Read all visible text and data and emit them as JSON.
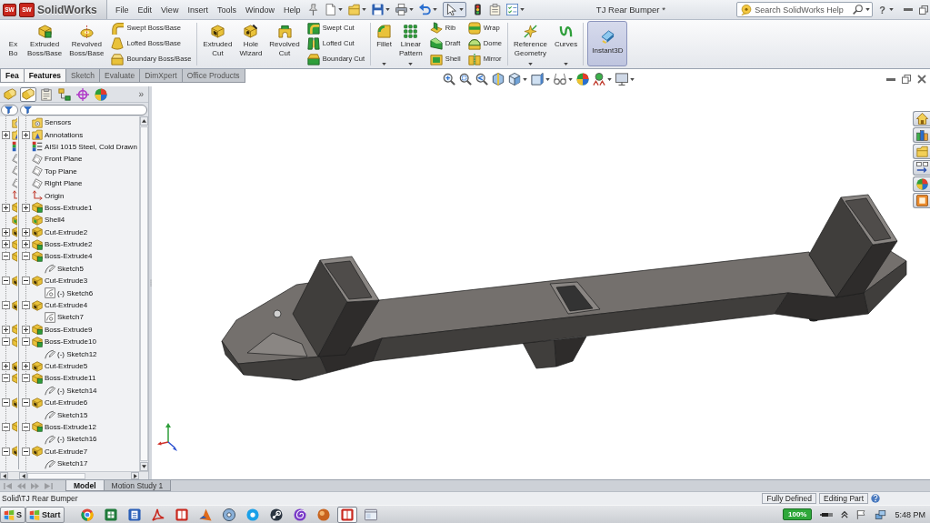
{
  "title_bar": {
    "app_icon_mark": "SW",
    "logo": {
      "mark": "SW",
      "text": "SolidWorks"
    },
    "menu": [
      "File",
      "Edit",
      "View",
      "Insert",
      "Tools",
      "Window",
      "Help"
    ],
    "select_tool": {
      "pressed": true
    },
    "document_title": "TJ Rear Bumper *",
    "search": {
      "placeholder": "Search SolidWorks Help"
    },
    "help_glyph": "?"
  },
  "command_manager": {
    "groups": [
      {
        "tools": [
          {
            "kind": "large",
            "label": "Ex Bo",
            "dropdown": false
          },
          {
            "kind": "large",
            "label": "Extruded Boss/Base",
            "dropdown": false
          },
          {
            "kind": "large",
            "label": "Revolved Boss/Base",
            "dropdown": false
          },
          {
            "kind": "stack",
            "items": [
              "Swept Boss/Base",
              "Lofted Boss/Base",
              "Boundary Boss/Base"
            ]
          }
        ]
      },
      {
        "tools": [
          {
            "kind": "large",
            "label": "Extruded Cut",
            "dropdown": false
          },
          {
            "kind": "large",
            "label": "Hole Wizard",
            "dropdown": false
          },
          {
            "kind": "large",
            "label": "Revolved Cut",
            "dropdown": false
          },
          {
            "kind": "stack",
            "items": [
              "Swept Cut",
              "Lofted Cut",
              "Boundary Cut"
            ]
          }
        ]
      },
      {
        "tools": [
          {
            "kind": "large",
            "label": "Fillet",
            "dropdown": true
          },
          {
            "kind": "large",
            "label": "Linear Pattern",
            "dropdown": true
          },
          {
            "kind": "stack",
            "items": [
              "Rib",
              "Draft",
              "Shell"
            ]
          },
          {
            "kind": "stack",
            "items": [
              "Wrap",
              "Dome",
              "Mirror"
            ]
          }
        ]
      },
      {
        "tools": [
          {
            "kind": "large",
            "label": "Reference Geometry",
            "dropdown": true
          },
          {
            "kind": "large",
            "label": "Curves",
            "dropdown": true
          }
        ]
      },
      {
        "tools": [
          {
            "kind": "toggle",
            "label": "Instant3D",
            "on": true
          }
        ]
      }
    ]
  },
  "tabs": [
    {
      "label": "Fea",
      "selected": true
    },
    {
      "label": "Features",
      "selected": true
    },
    {
      "label": "Sketch",
      "selected": false
    },
    {
      "label": "Evaluate",
      "selected": false
    },
    {
      "label": "DimXpert",
      "selected": false
    },
    {
      "label": "Office Products",
      "selected": false
    }
  ],
  "feature_tree": {
    "panel_tabs": [
      {
        "selected": false
      },
      {
        "selected": true
      },
      {
        "selected": false
      },
      {
        "selected": false
      },
      {
        "selected": false
      },
      {
        "selected": false
      }
    ],
    "overflow_glyph": "»",
    "items": [
      {
        "label": "Sensors",
        "kind": "sensors"
      },
      {
        "label": "Annotations",
        "kind": "annotations",
        "expanded": false
      },
      {
        "label": "AISI 1015 Steel, Cold Drawn",
        "kind": "material"
      },
      {
        "label": "Front Plane",
        "kind": "plane"
      },
      {
        "label": "Top Plane",
        "kind": "plane"
      },
      {
        "label": "Right Plane",
        "kind": "plane"
      },
      {
        "label": "Origin",
        "kind": "origin"
      },
      {
        "label": "Boss-Extrude1",
        "kind": "boss",
        "expanded": false
      },
      {
        "label": "Shell4",
        "kind": "shell"
      },
      {
        "label": "Cut-Extrude2",
        "kind": "cut",
        "expanded": false
      },
      {
        "label": "Boss-Extrude2",
        "kind": "boss",
        "expanded": false
      },
      {
        "label": "Boss-Extrude4",
        "kind": "boss",
        "expanded": true,
        "children": [
          {
            "label": "Sketch5",
            "kind": "sketch"
          }
        ]
      },
      {
        "label": "Cut-Extrude3",
        "kind": "cut",
        "expanded": true,
        "children": [
          {
            "label": "(-) Sketch6",
            "kind": "sketchbox"
          }
        ]
      },
      {
        "label": "Cut-Extrude4",
        "kind": "cut",
        "expanded": true,
        "children": [
          {
            "label": "Sketch7",
            "kind": "sketchbox"
          }
        ]
      },
      {
        "label": "Boss-Extrude9",
        "kind": "boss",
        "expanded": false
      },
      {
        "label": "Boss-Extrude10",
        "kind": "boss",
        "expanded": true,
        "children": [
          {
            "label": "(-) Sketch12",
            "kind": "sketch"
          }
        ]
      },
      {
        "label": "Cut-Extrude5",
        "kind": "cut",
        "expanded": false
      },
      {
        "label": "Boss-Extrude11",
        "kind": "boss",
        "expanded": true,
        "children": [
          {
            "label": "(-) Sketch14",
            "kind": "sketch"
          }
        ]
      },
      {
        "label": "Cut-Extrude6",
        "kind": "cut",
        "expanded": true,
        "children": [
          {
            "label": "Sketch15",
            "kind": "sketch"
          }
        ]
      },
      {
        "label": "Boss-Extrude12",
        "kind": "boss",
        "expanded": true,
        "children": [
          {
            "label": "(-) Sketch16",
            "kind": "sketch"
          }
        ]
      },
      {
        "label": "Cut-Extrude7",
        "kind": "cut",
        "expanded": true,
        "children": [
          {
            "label": "Sketch17",
            "kind": "sketch"
          }
        ]
      }
    ]
  },
  "model_tab_bar": {
    "nav_disabled": true,
    "tabs": [
      {
        "label": "Model",
        "selected": true
      },
      {
        "label": "Motion Study 1",
        "selected": false
      }
    ]
  },
  "status_bar": {
    "path": "Solid\\TJ Rear Bumper",
    "fields": [
      "Fully Defined",
      "Editing Part"
    ]
  },
  "taskbar": {
    "start_buttons": [
      "S",
      "Start"
    ],
    "apps": [
      {
        "active": false
      },
      {
        "active": false
      },
      {
        "active": false
      },
      {
        "active": false
      },
      {
        "active": false
      },
      {
        "active": false
      },
      {
        "active": false
      },
      {
        "active": false
      },
      {
        "active": false
      },
      {
        "active": false
      },
      {
        "active": false
      },
      {
        "active": true
      },
      {
        "active": false
      }
    ],
    "battery": "100%",
    "clock": "5:48 PM"
  }
}
